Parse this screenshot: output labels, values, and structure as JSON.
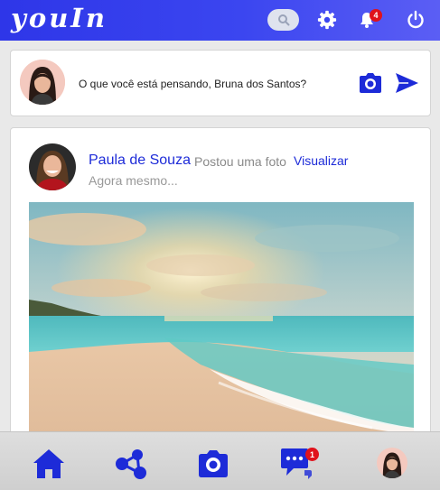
{
  "app": {
    "brand": "youIn"
  },
  "header": {
    "icons": [
      "search-icon",
      "gear-icon",
      "bell-icon",
      "power-icon"
    ],
    "notifications_count": "4",
    "colors": {
      "gradient_start": "#2e36e8",
      "gradient_end": "#5b5ef4"
    }
  },
  "composer": {
    "prompt": "O que você está pensando, Bruna dos Santos?",
    "icons": [
      "camera-icon",
      "send-icon"
    ]
  },
  "post": {
    "author": "Paula de Souza",
    "action": "Postou uma foto",
    "view_link": "Visualizar",
    "time": "Agora mesmo..."
  },
  "bottom_nav": {
    "items": [
      "home-icon",
      "share-icon",
      "camera-icon",
      "chat-icon",
      "profile-avatar"
    ],
    "chat_count": "1"
  },
  "colors": {
    "accent": "#1d2bd8",
    "badge": "#e0121b"
  }
}
